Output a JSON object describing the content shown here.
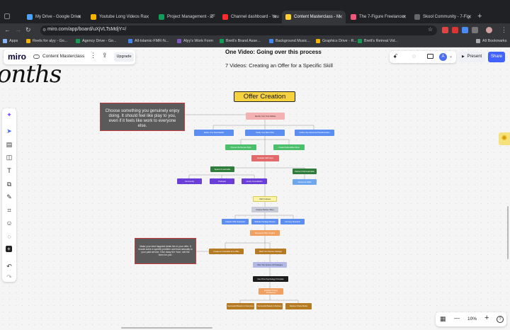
{
  "browser": {
    "tabs": [
      {
        "label": "My Drive - Google Drive",
        "color": "#4aa3ff"
      },
      {
        "label": "Youtube Long Videos Ra",
        "color": "#f4b400"
      },
      {
        "label": "Project Management - 7F",
        "color": "#0f9d58"
      },
      {
        "label": "Channel dashboard - You",
        "color": "#ff2b2b"
      },
      {
        "label": "Content Masterclass - M",
        "color": "#ffd02f"
      },
      {
        "label": "The 7-Figure Freelancer",
        "color": "#f05a78"
      },
      {
        "label": "Skool Community - 7-Fig",
        "color": "#444444"
      }
    ],
    "new_tab": "+",
    "url": "miro.com/app/board/uXjVLTsMdjY=/",
    "bookmarks": [
      {
        "label": "Apps"
      },
      {
        "label": "Reels for alyy - Go..."
      },
      {
        "label": "Agency Drive - Go..."
      },
      {
        "label": "All-Islamic-FMR-N..."
      },
      {
        "label": "Alyy's Work Form"
      },
      {
        "label": "Brett's Brand Asse..."
      },
      {
        "label": "Background Music..."
      },
      {
        "label": "Graphics Drive - R..."
      },
      {
        "label": "Brett's Retreat Vid..."
      }
    ],
    "all_bookmarks": "All Bookmarks"
  },
  "miro": {
    "logo": "miro",
    "board_name": "Content Masterclass",
    "upgrade": "Upgrade",
    "avatar": "A",
    "present": "Present",
    "share": "Share",
    "zoom": "10%",
    "help": "?",
    "zoom_out": "—",
    "zoom_in": "+"
  },
  "canvas": {
    "header_line1": "One Video: Going over this process",
    "header_line2": "7 Videos: Creating an Offer for a Specific Skill",
    "big_script": "onths",
    "title": "Offer Creation",
    "note1": "Choose something you genuinely enjoy doing. It should feel like play to you, even if it feels like work to everyone else.",
    "note2": "Make your best happiest deals live in your offer. It should solve a specific problem and lead naturally to your paid service. Give away the 'how', sell the 'done-for-you'."
  },
  "nodes": [
    {
      "label": "Identify Your Core Skillset"
    },
    {
      "label": "Define Your Ideal Market"
    },
    {
      "label": "Clarify Your Main Offer"
    },
    {
      "label": "Outline the Outcomes/Transformation"
    },
    {
      "label": "Choose the Service Style"
    },
    {
      "label": "Create Deliverables Menu"
    },
    {
      "label": "Evaluate Skill Gaps"
    },
    {
      "label": "Speed of Learnable"
    },
    {
      "label": "Partner if Not Learnable"
    },
    {
      "label": "Community"
    },
    {
      "label": "Podcasts"
    },
    {
      "label": "Hourly Consultation"
    },
    {
      "label": "Outsource Skills"
    },
    {
      "label": "Skill Finalised"
    },
    {
      "label": "Analyse Market Offers"
    },
    {
      "label": "Linkedin Offer Examples"
    },
    {
      "label": "Website Package Review"
    },
    {
      "label": "Ad Copy Research"
    },
    {
      "label": "Structured Offer Insights"
    },
    {
      "label": "Create an Irresistible Free Offer"
    },
    {
      "label": "Build Your Service Package"
    },
    {
      "label": "Offer The Options Of Packages"
    },
    {
      "label": "Use Price Psychology Principles"
    },
    {
      "label": "Establish Pricing Architecture"
    },
    {
      "label": "Successful Based on Outcomes"
    },
    {
      "label": "Successful Based on Delivery"
    },
    {
      "label": "Retainer Share Model"
    }
  ]
}
